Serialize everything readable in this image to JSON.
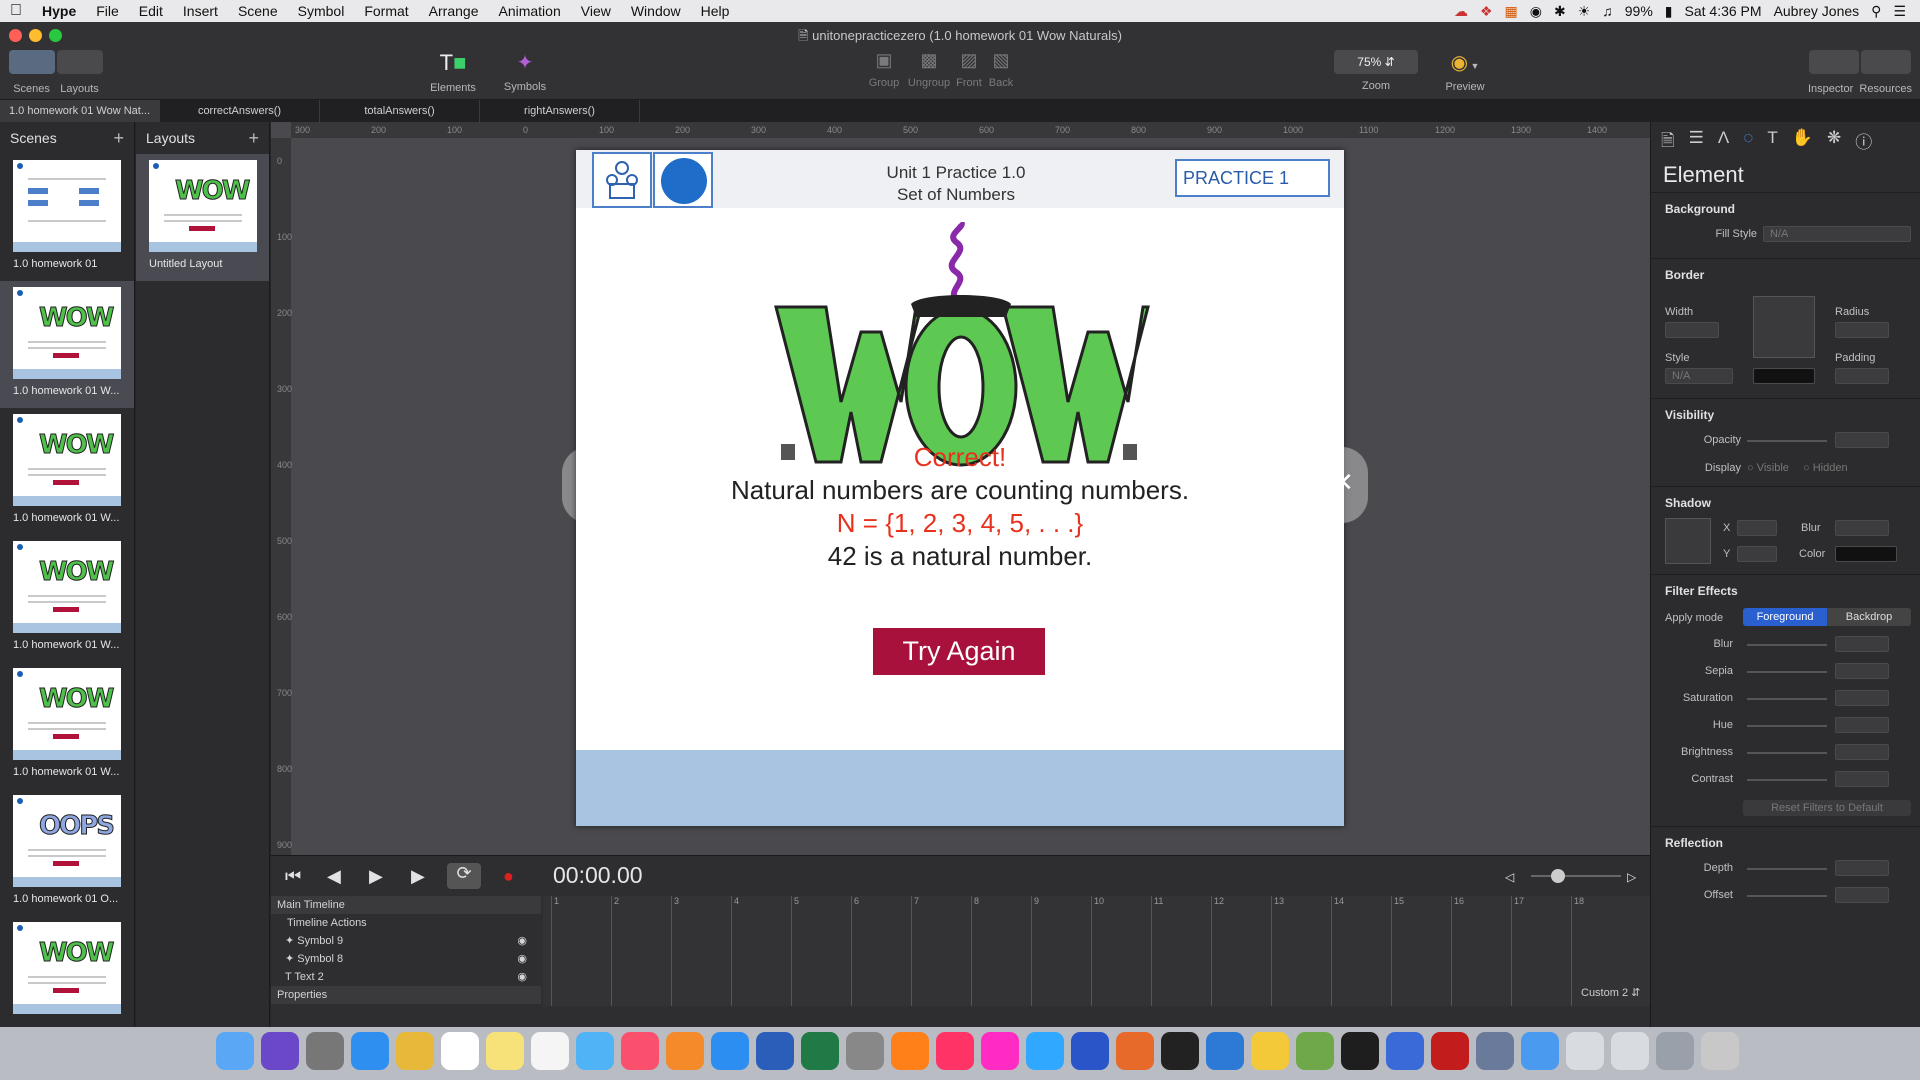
{
  "menubar": {
    "app": "Hype",
    "items": [
      "File",
      "Edit",
      "Insert",
      "Scene",
      "Symbol",
      "Format",
      "Arrange",
      "Animation",
      "View",
      "Window",
      "Help"
    ],
    "battery": "99%",
    "clock": "Sat 4:36 PM",
    "user": "Aubrey Jones"
  },
  "window": {
    "title": "unitonepracticezero (1.0 homework 01 Wow Naturals)"
  },
  "toolbar": {
    "scenes": "Scenes",
    "layouts": "Layouts",
    "elements": "Elements",
    "symbols": "Symbols",
    "group": "Group",
    "ungroup": "Ungroup",
    "front": "Front",
    "back": "Back",
    "zoom_value": "75%",
    "zoom": "Zoom",
    "preview": "Preview",
    "inspector": "Inspector",
    "resources": "Resources"
  },
  "tabs": [
    "1.0 homework 01 Wow Nat...",
    "correctAnswers()",
    "totalAnswers()",
    "rightAnswers()"
  ],
  "scenes_panel": {
    "title": "Scenes",
    "items": [
      {
        "name": "1.0 homework 01"
      },
      {
        "name": "1.0 homework 01 W..."
      },
      {
        "name": "1.0 homework 01 W..."
      },
      {
        "name": "1.0 homework 01 W..."
      },
      {
        "name": "1.0 homework 01 W..."
      },
      {
        "name": "1.0 homework 01 O..."
      },
      {
        "name": ""
      }
    ]
  },
  "layouts_panel": {
    "title": "Layouts",
    "items": [
      {
        "name": "Untitled Layout"
      }
    ]
  },
  "ruler": {
    "h_ticks": [
      "300",
      "200",
      "100",
      "0",
      "100",
      "200",
      "300",
      "400",
      "500",
      "600",
      "700",
      "800",
      "900",
      "1000",
      "1100",
      "1200",
      "1300",
      "1400"
    ],
    "v_ticks": [
      "0",
      "100",
      "200",
      "300",
      "400",
      "500",
      "600",
      "700",
      "800",
      "900"
    ]
  },
  "stage": {
    "unit_line1": "Unit 1 Practice 1.0",
    "unit_line2": "Set of Numbers",
    "practice": "PRACTICE 1",
    "wow": "WOW",
    "correct": "Correct!",
    "line1": "Natural numbers are counting numbers.",
    "line2": "N = {1, 2, 3, 4, 5, . . .}",
    "line3": "42 is a natural number.",
    "button": "Try Again",
    "colors": {
      "correct": "#e8311d",
      "button": "#a8113c",
      "footer": "#a8c4e0",
      "wow": "#4fc14a"
    }
  },
  "timeline": {
    "timecode": "00:00.00",
    "main": "Main Timeline",
    "actions": "Timeline Actions",
    "layers": [
      "Symbol 9",
      "Symbol 8",
      "Text 2"
    ],
    "properties": "Properties",
    "custom": "Custom 2",
    "ticks": [
      "1",
      "2",
      "3",
      "4",
      "5",
      "6",
      "7",
      "8",
      "9",
      "10",
      "11",
      "12",
      "13",
      "14",
      "15",
      "16",
      "17",
      "18"
    ]
  },
  "inspector": {
    "title": "Element",
    "background": "Background",
    "fill_style": "Fill Style",
    "fill_value": "N/A",
    "border": "Border",
    "width": "Width",
    "radius": "Radius",
    "style": "Style",
    "style_value": "N/A",
    "padding": "Padding",
    "visibility": "Visibility",
    "opacity": "Opacity",
    "display": "Display",
    "visible": "Visible",
    "hidden": "Hidden",
    "shadow": "Shadow",
    "x": "X",
    "y": "Y",
    "blur": "Blur",
    "color": "Color",
    "filter_effects": "Filter Effects",
    "apply_mode": "Apply mode",
    "foreground": "Foreground",
    "backdrop": "Backdrop",
    "filters": [
      "Blur",
      "Sepia",
      "Saturation",
      "Hue",
      "Brightness",
      "Contrast"
    ],
    "reset": "Reset Filters to Default",
    "reflection": "Reflection",
    "depth": "Depth",
    "offset": "Offset"
  },
  "dock": [
    "Finder",
    "Siri",
    "Launchpad",
    "Safari",
    "Chrome",
    "Calendar",
    "Notes",
    "Reminders",
    "Messages",
    "Music",
    "Books",
    "App Store",
    "Word",
    "Excel",
    "System Preferences",
    "Illustrator",
    "InDesign",
    "XD",
    "Photoshop",
    "Animate",
    "Hype",
    "Terminal",
    "VS Code",
    "Cyberduck",
    "Minecraft",
    "Figma",
    "QuickTime",
    "Flash",
    "Preview",
    "Folder",
    "Documents",
    "Files",
    "Downloads",
    "Trash"
  ]
}
